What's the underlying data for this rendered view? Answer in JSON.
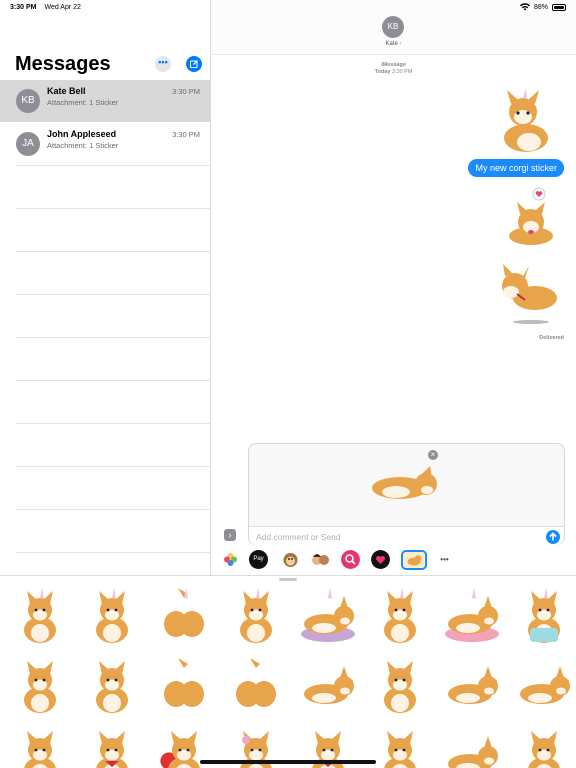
{
  "status_bar": {
    "time": "3:30 PM",
    "date": "Wed Apr 22",
    "battery": "88%"
  },
  "sidebar": {
    "title": "Messages",
    "more_glyph": "•••",
    "conversations": [
      {
        "initials": "KB",
        "name": "Kate Bell",
        "preview": "Attachment: 1 Sticker",
        "time": "3:30 PM",
        "selected": true
      },
      {
        "initials": "JA",
        "name": "John Appleseed",
        "preview": "Attachment: 1 Sticker",
        "time": "3:30 PM",
        "selected": false
      }
    ]
  },
  "chat": {
    "contact_initials": "KB",
    "contact_name": "Kate",
    "chevron": "›",
    "service": "iMessage",
    "day": "Today",
    "time": "3:30 PM",
    "message": "My new corgi sticker",
    "status": "Delivered",
    "composer": {
      "placeholder": "Add comment or Send",
      "expand_glyph": "›",
      "remove_glyph": "×"
    }
  },
  "app_drawer": {
    "apps": [
      "photos-icon",
      "apple-pay-icon",
      "animoji-icon",
      "memoji-icon",
      "image-search-icon",
      "digital-touch-icon",
      "corgi-sticker-app-icon",
      "more-apps-icon"
    ],
    "more_glyph": "•••",
    "pay_label": "Pay"
  },
  "colors": {
    "accent": "#1a8bfb",
    "bubble": "#1a8bfb",
    "corgi_orange": "#e8a44a",
    "corgi_cream": "#fdf3e4",
    "selected_row": "#d8d8d8"
  },
  "stickers": [
    "corgi-unicorn-sit",
    "corgi-unicorn-sit",
    "corgi-unicorn-butt",
    "corgi-unicorn-sit",
    "corgi-unicorn-bed",
    "corgi-unicorn-sit",
    "corgi-unicorn-pillow",
    "corgi-unicorn-shirt",
    "corgi-sit",
    "corgi-sit",
    "corgi-butt",
    "corgi-butt",
    "corgi-lie",
    "corgi-stand",
    "corgi-sleep",
    "corgi-run",
    "corgi-peek",
    "corgi-bandana",
    "corgi-heart",
    "corgi-flower",
    "corgi-bowtie",
    "corgi-bowl",
    "corgi-run",
    "corgi-sit"
  ]
}
